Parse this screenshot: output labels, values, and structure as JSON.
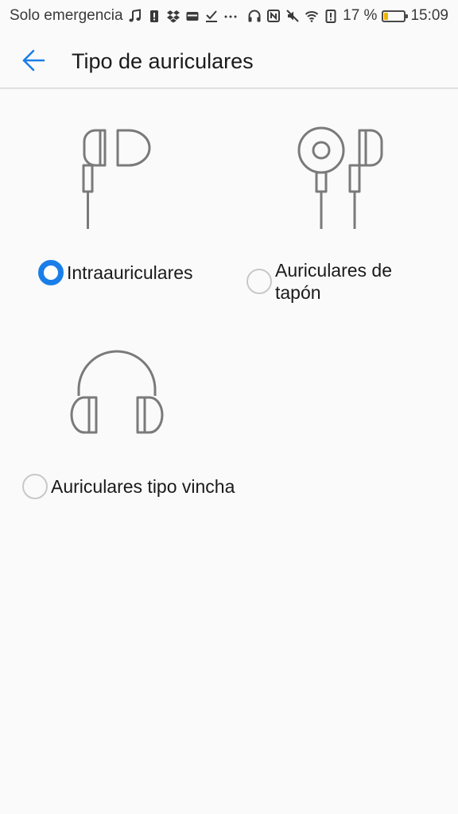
{
  "status_bar": {
    "carrier": "Solo emergencia",
    "battery_text": "17 %",
    "battery_level": 0.17,
    "time": "15:09",
    "icons_left": [
      "music-icon",
      "alert-icon",
      "dropbox-icon",
      "card-icon",
      "check-icon",
      "more-icon"
    ],
    "icons_right": [
      "headphones-icon",
      "nfc-icon",
      "mute-icon",
      "wifi-icon",
      "battery-alert-icon",
      "battery-icon"
    ]
  },
  "app_bar": {
    "title": "Tipo de auriculares",
    "back_icon": "arrow-left-icon"
  },
  "options": [
    {
      "label": "Intraauriculares",
      "checked": true,
      "icon": "in-ear-earphones-icon"
    },
    {
      "label": "Auriculares de tapón",
      "checked": false,
      "icon": "earbud-earphones-icon"
    },
    {
      "label": "Auriculares tipo vincha",
      "checked": false,
      "icon": "headband-headphones-icon"
    }
  ],
  "colors": {
    "accent": "#1a7ee8",
    "background": "#fafafa",
    "icon_stroke": "#7a7a7a",
    "battery_fill": "#f0b400"
  }
}
